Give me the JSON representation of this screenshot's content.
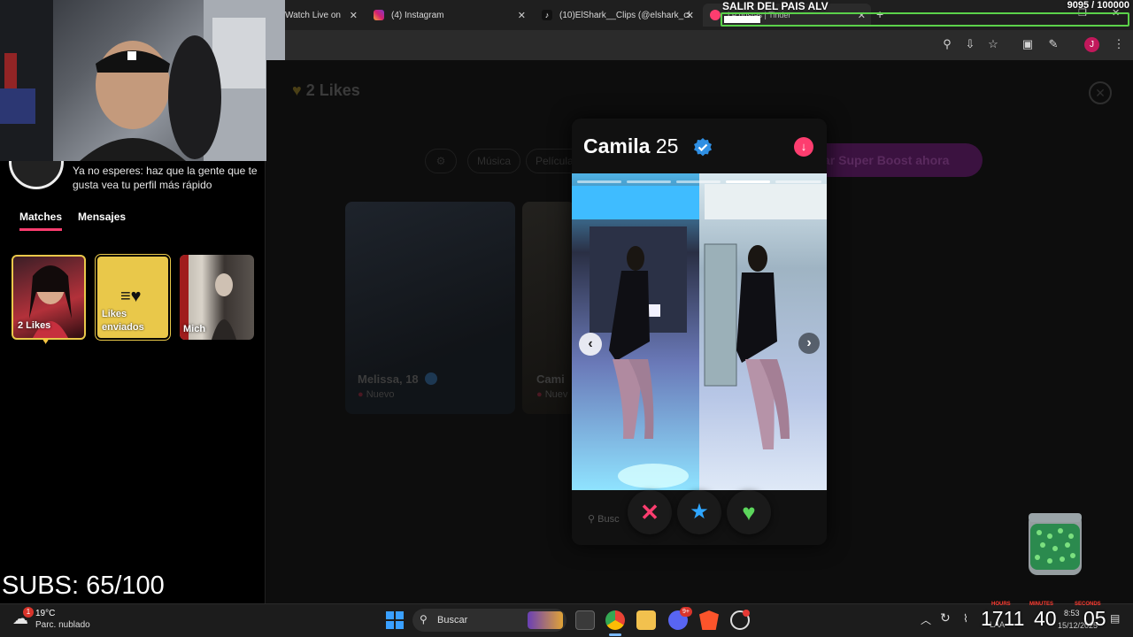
{
  "browser": {
    "tabs": [
      {
        "label": "Watch Live on",
        "icon": "twitch-icon"
      },
      {
        "label": "(4) Instagram",
        "icon": "instagram-icon"
      },
      {
        "label": "(10)ElShark__Clips (@elshark_cl",
        "icon": "tiktok-icon"
      },
      {
        "label": "Le gustas | Tinder",
        "icon": "tinder-icon"
      }
    ],
    "toolbar_icons": [
      "location-icon",
      "install-icon",
      "star-icon",
      "sidebar-icon",
      "extensions-icon",
      "profile-avatar",
      "menu-icon"
    ],
    "profile_initial": "J"
  },
  "stream": {
    "goal_title": "SALIR DEL PAIS ALV",
    "goal_progress": "9095  / 100000",
    "goal_value": 9095,
    "goal_target": 100000,
    "subs_counter": "SUBS: 65/100"
  },
  "sidebar": {
    "boost_text": "Ya no esperes: haz que la gente que te gusta vea tu perfil más rápido",
    "tabs": [
      {
        "label": "Matches",
        "active": true
      },
      {
        "label": "Mensajes",
        "active": false
      }
    ],
    "cards": [
      {
        "label": "2 Likes"
      },
      {
        "label": "Likes enviados"
      },
      {
        "label": "Mich"
      }
    ]
  },
  "main": {
    "header": "2 Likes",
    "filters": [
      "Música",
      "Película"
    ],
    "boost_button": "ar Super Boost ahora",
    "bg_cards": [
      {
        "name": "Melissa, 18",
        "status": "Nuevo"
      },
      {
        "name": "Cami",
        "status": "Nuev"
      }
    ]
  },
  "profile": {
    "name": "Camila",
    "age": "25",
    "search_placeholder": "Busc",
    "photo_count": 5
  },
  "taskbar": {
    "weather_temp": "19°C",
    "weather_desc": "Parc. nublado",
    "weather_badge": "1",
    "search_label": "Buscar",
    "discord_badge": "9+",
    "lang": "LAA",
    "time": "8:53",
    "date": "15/12/2025",
    "timer_labels": [
      "HOURS",
      "MINUTES",
      "SECONDS"
    ],
    "timer_values": [
      "1711",
      "40",
      "05"
    ]
  },
  "colors": {
    "tinder_pink": "#fd3d6f",
    "goal_green": "#5bd14a",
    "verified_blue": "#2f8fe3",
    "likes_gold": "#e9c84a"
  }
}
